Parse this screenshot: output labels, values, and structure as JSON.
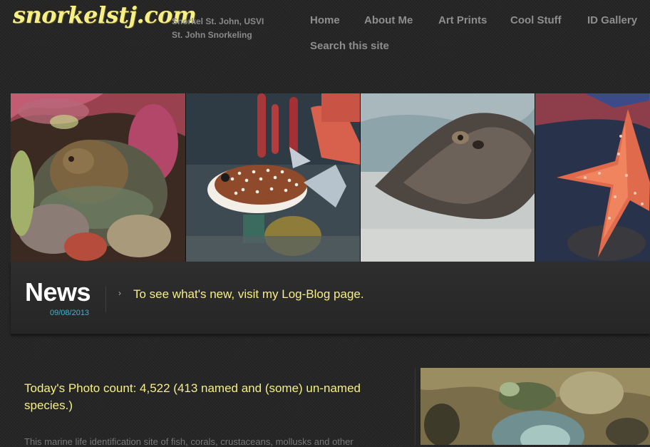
{
  "header": {
    "logo": "snorkelstj.com",
    "tagline_line1": "Snorkel St. John, USVI",
    "tagline_line2": "St. John Snorkeling"
  },
  "nav": {
    "items": [
      "Home",
      "About Me",
      "Art Prints",
      "Cool Stuff",
      "ID Gallery"
    ],
    "search": "Search this site"
  },
  "banner": {
    "panels": [
      "octopus-photo",
      "trunkfish-photo",
      "stingray-photo",
      "starfish-photo"
    ]
  },
  "news": {
    "title": "News",
    "date": "09/08/2013",
    "text": "To see what's new, visit my Log-Blog page."
  },
  "content": {
    "photo_count": "Today's Photo count: 4,522 (413 named and (some) un-named species.)",
    "intro": "This marine life identification site of fish, corals, crustaceans, mollusks and other"
  },
  "colors": {
    "logo": "#f6ee86",
    "accent_text": "#f6ee86",
    "date": "#3fb6d0",
    "nav": "#8e8e8e",
    "background": "#262626"
  }
}
